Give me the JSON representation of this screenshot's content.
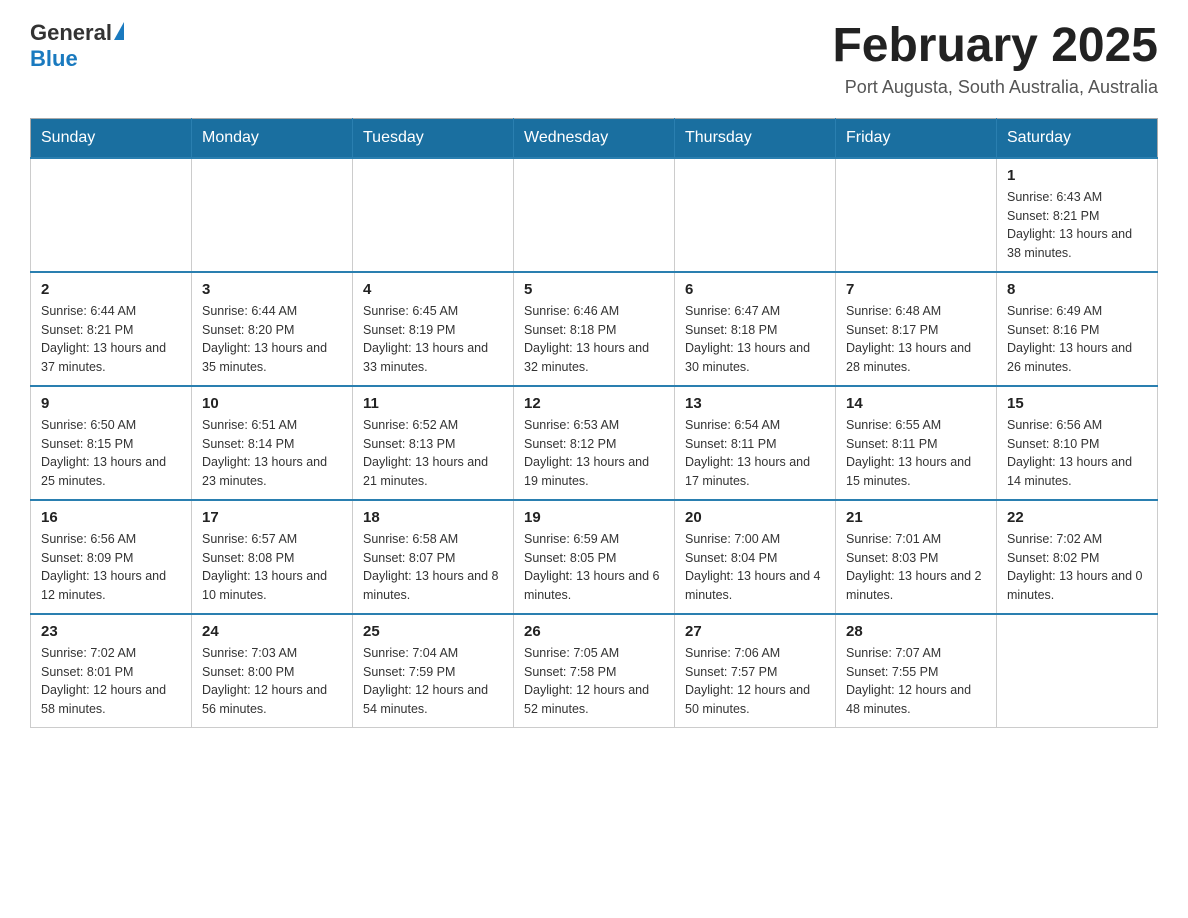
{
  "header": {
    "logo_general": "General",
    "logo_blue": "Blue",
    "month_title": "February 2025",
    "location": "Port Augusta, South Australia, Australia"
  },
  "days_of_week": [
    "Sunday",
    "Monday",
    "Tuesday",
    "Wednesday",
    "Thursday",
    "Friday",
    "Saturday"
  ],
  "weeks": [
    {
      "days": [
        {
          "number": "",
          "info": ""
        },
        {
          "number": "",
          "info": ""
        },
        {
          "number": "",
          "info": ""
        },
        {
          "number": "",
          "info": ""
        },
        {
          "number": "",
          "info": ""
        },
        {
          "number": "",
          "info": ""
        },
        {
          "number": "1",
          "info": "Sunrise: 6:43 AM\nSunset: 8:21 PM\nDaylight: 13 hours and 38 minutes."
        }
      ]
    },
    {
      "days": [
        {
          "number": "2",
          "info": "Sunrise: 6:44 AM\nSunset: 8:21 PM\nDaylight: 13 hours and 37 minutes."
        },
        {
          "number": "3",
          "info": "Sunrise: 6:44 AM\nSunset: 8:20 PM\nDaylight: 13 hours and 35 minutes."
        },
        {
          "number": "4",
          "info": "Sunrise: 6:45 AM\nSunset: 8:19 PM\nDaylight: 13 hours and 33 minutes."
        },
        {
          "number": "5",
          "info": "Sunrise: 6:46 AM\nSunset: 8:18 PM\nDaylight: 13 hours and 32 minutes."
        },
        {
          "number": "6",
          "info": "Sunrise: 6:47 AM\nSunset: 8:18 PM\nDaylight: 13 hours and 30 minutes."
        },
        {
          "number": "7",
          "info": "Sunrise: 6:48 AM\nSunset: 8:17 PM\nDaylight: 13 hours and 28 minutes."
        },
        {
          "number": "8",
          "info": "Sunrise: 6:49 AM\nSunset: 8:16 PM\nDaylight: 13 hours and 26 minutes."
        }
      ]
    },
    {
      "days": [
        {
          "number": "9",
          "info": "Sunrise: 6:50 AM\nSunset: 8:15 PM\nDaylight: 13 hours and 25 minutes."
        },
        {
          "number": "10",
          "info": "Sunrise: 6:51 AM\nSunset: 8:14 PM\nDaylight: 13 hours and 23 minutes."
        },
        {
          "number": "11",
          "info": "Sunrise: 6:52 AM\nSunset: 8:13 PM\nDaylight: 13 hours and 21 minutes."
        },
        {
          "number": "12",
          "info": "Sunrise: 6:53 AM\nSunset: 8:12 PM\nDaylight: 13 hours and 19 minutes."
        },
        {
          "number": "13",
          "info": "Sunrise: 6:54 AM\nSunset: 8:11 PM\nDaylight: 13 hours and 17 minutes."
        },
        {
          "number": "14",
          "info": "Sunrise: 6:55 AM\nSunset: 8:11 PM\nDaylight: 13 hours and 15 minutes."
        },
        {
          "number": "15",
          "info": "Sunrise: 6:56 AM\nSunset: 8:10 PM\nDaylight: 13 hours and 14 minutes."
        }
      ]
    },
    {
      "days": [
        {
          "number": "16",
          "info": "Sunrise: 6:56 AM\nSunset: 8:09 PM\nDaylight: 13 hours and 12 minutes."
        },
        {
          "number": "17",
          "info": "Sunrise: 6:57 AM\nSunset: 8:08 PM\nDaylight: 13 hours and 10 minutes."
        },
        {
          "number": "18",
          "info": "Sunrise: 6:58 AM\nSunset: 8:07 PM\nDaylight: 13 hours and 8 minutes."
        },
        {
          "number": "19",
          "info": "Sunrise: 6:59 AM\nSunset: 8:05 PM\nDaylight: 13 hours and 6 minutes."
        },
        {
          "number": "20",
          "info": "Sunrise: 7:00 AM\nSunset: 8:04 PM\nDaylight: 13 hours and 4 minutes."
        },
        {
          "number": "21",
          "info": "Sunrise: 7:01 AM\nSunset: 8:03 PM\nDaylight: 13 hours and 2 minutes."
        },
        {
          "number": "22",
          "info": "Sunrise: 7:02 AM\nSunset: 8:02 PM\nDaylight: 13 hours and 0 minutes."
        }
      ]
    },
    {
      "days": [
        {
          "number": "23",
          "info": "Sunrise: 7:02 AM\nSunset: 8:01 PM\nDaylight: 12 hours and 58 minutes."
        },
        {
          "number": "24",
          "info": "Sunrise: 7:03 AM\nSunset: 8:00 PM\nDaylight: 12 hours and 56 minutes."
        },
        {
          "number": "25",
          "info": "Sunrise: 7:04 AM\nSunset: 7:59 PM\nDaylight: 12 hours and 54 minutes."
        },
        {
          "number": "26",
          "info": "Sunrise: 7:05 AM\nSunset: 7:58 PM\nDaylight: 12 hours and 52 minutes."
        },
        {
          "number": "27",
          "info": "Sunrise: 7:06 AM\nSunset: 7:57 PM\nDaylight: 12 hours and 50 minutes."
        },
        {
          "number": "28",
          "info": "Sunrise: 7:07 AM\nSunset: 7:55 PM\nDaylight: 12 hours and 48 minutes."
        },
        {
          "number": "",
          "info": ""
        }
      ]
    }
  ]
}
